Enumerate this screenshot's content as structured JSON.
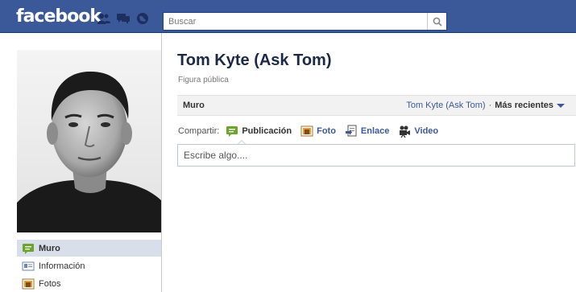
{
  "header": {
    "logo": "facebook",
    "search": {
      "placeholder": "Buscar"
    },
    "jewels": [
      "friend-requests-icon",
      "messages-icon",
      "notifications-icon"
    ]
  },
  "profile": {
    "name": "Tom Kyte (Ask Tom)",
    "category": "Figura pública"
  },
  "left_nav": {
    "items": [
      {
        "label": "Muro",
        "icon": "wall-icon",
        "active": true
      },
      {
        "label": "Información",
        "icon": "info-icon",
        "active": false
      },
      {
        "label": "Fotos",
        "icon": "photos-icon",
        "active": false
      }
    ]
  },
  "wall_bar": {
    "title": "Muro",
    "filter_name": "Tom Kyte (Ask Tom)",
    "separator": "·",
    "filter_recent": "Más recientes"
  },
  "composer": {
    "share_label": "Compartir:",
    "options": [
      {
        "label": "Publicación",
        "icon": "status-icon"
      },
      {
        "label": "Foto",
        "icon": "photo-icon"
      },
      {
        "label": "Enlace",
        "icon": "link-icon"
      },
      {
        "label": "Video",
        "icon": "video-icon"
      }
    ],
    "placeholder": "Escribe algo...."
  },
  "colors": {
    "brand_blue": "#3b5998",
    "nav_active": "#d8dfea",
    "title_dark": "#1c2a47"
  }
}
